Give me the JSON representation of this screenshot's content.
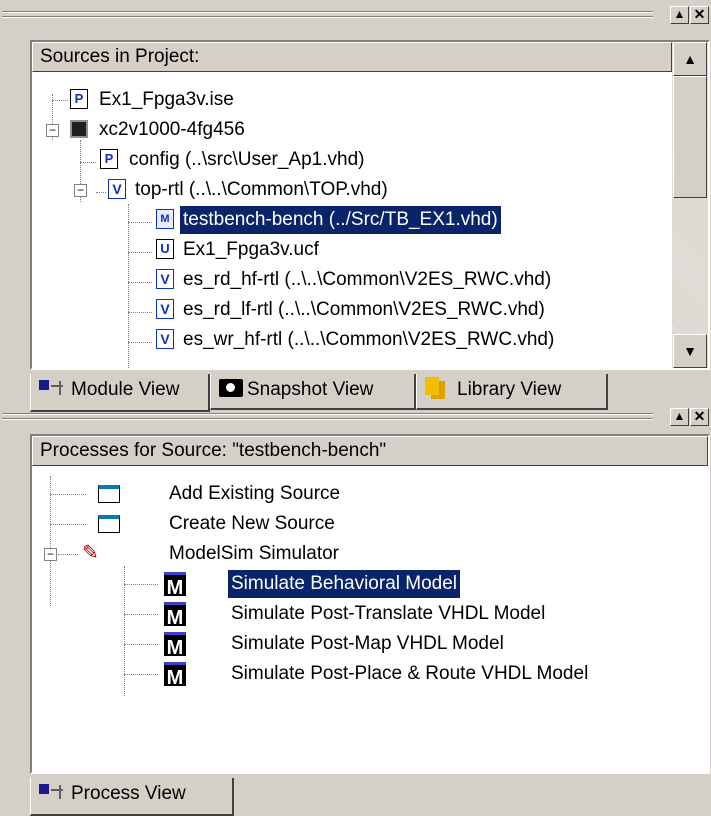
{
  "window": {
    "grip_max_glyph": "▲",
    "grip_close_glyph": "✕"
  },
  "sources": {
    "header": "Sources in Project:",
    "items": [
      {
        "label": "Ex1_Fpga3v.ise",
        "icon": "project-file-icon"
      },
      {
        "label": "xc2v1000-4fg456",
        "icon": "chip-icon",
        "expander": "−"
      },
      {
        "label": "config (..\\src\\User_Ap1.vhd)",
        "icon": "package-file-icon"
      },
      {
        "label": "top-rtl (..\\..\\Common\\TOP.vhd)",
        "icon": "vhdl-file-icon",
        "expander": "−"
      },
      {
        "label": "testbench-bench (../Src/TB_EX1.vhd)",
        "icon": "testbench-file-icon",
        "selected": true
      },
      {
        "label": "Ex1_Fpga3v.ucf",
        "icon": "ucf-file-icon"
      },
      {
        "label": "es_rd_hf-rtl (..\\..\\Common\\V2ES_RWC.vhd)",
        "icon": "vhdl-file-icon"
      },
      {
        "label": "es_rd_lf-rtl (..\\..\\Common\\V2ES_RWC.vhd)",
        "icon": "vhdl-file-icon"
      },
      {
        "label": "es_wr_hf-rtl (..\\..\\Common\\V2ES_RWC.vhd)",
        "icon": "vhdl-file-icon"
      }
    ],
    "tabs": [
      {
        "label": "Module View",
        "icon": "module-view-icon",
        "active": true
      },
      {
        "label": "Snapshot View",
        "icon": "snapshot-camera-icon"
      },
      {
        "label": "Library View",
        "icon": "library-books-icon"
      }
    ]
  },
  "processes": {
    "header": "Processes for Source:  \"testbench-bench\"",
    "items": [
      {
        "label": "Add Existing Source",
        "icon": "window-icon"
      },
      {
        "label": "Create New Source",
        "icon": "window-icon"
      },
      {
        "label": "ModelSim Simulator",
        "icon": "modelsim-icon",
        "expander": "−"
      },
      {
        "label": "Simulate Behavioral Model",
        "icon": "modelsim-m-icon",
        "selected": true
      },
      {
        "label": "Simulate Post-Translate VHDL Model",
        "icon": "modelsim-m-icon"
      },
      {
        "label": "Simulate Post-Map VHDL Model",
        "icon": "modelsim-m-icon"
      },
      {
        "label": "Simulate Post-Place & Route VHDL Model",
        "icon": "modelsim-m-icon"
      }
    ],
    "tabs": [
      {
        "label": "Process View",
        "icon": "module-view-icon",
        "active": true
      }
    ]
  },
  "icon_glyphs": {
    "project": "P",
    "package": "P",
    "vhdl": "V",
    "testbench": "M",
    "ucf": "U",
    "modelsim": "✎",
    "m": "M",
    "scroll_up": "▲",
    "scroll_down": "▼"
  }
}
